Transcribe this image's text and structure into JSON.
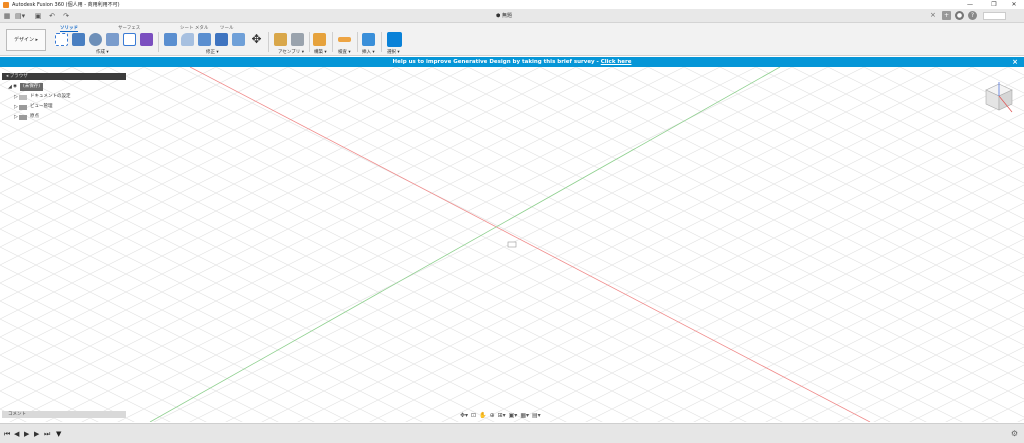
{
  "window": {
    "title": "Autodesk Fusion 360 (個人用 - 商用利用不可)",
    "doc_title": "無題"
  },
  "workspace": {
    "label": "デザイン ▸"
  },
  "tabs": [
    {
      "label": "ソリッド"
    },
    {
      "label": "サーフェス"
    },
    {
      "label": "シート メタル"
    },
    {
      "label": "ツール"
    }
  ],
  "groups": {
    "create": "作成 ▾",
    "modify": "修正 ▾",
    "assemble": "アセンブリ ▾",
    "construct": "構築 ▾",
    "inspect": "検査 ▾",
    "insert": "挿入 ▾",
    "select": "選択 ▾"
  },
  "banner": {
    "text": "Help us to improve Generative Design by taking this brief survey - ",
    "link": "Click here"
  },
  "browser": {
    "header": "ブラウザ",
    "root": "(未保存)",
    "items": [
      "ドキュメントの設定",
      "ビュー管理",
      "原点"
    ]
  },
  "comments": {
    "label": "コメント"
  },
  "colors": {
    "banner": "#0696d7",
    "axis_x": "#e88080",
    "axis_y": "#80c880",
    "grid": "#dcdcdc"
  }
}
